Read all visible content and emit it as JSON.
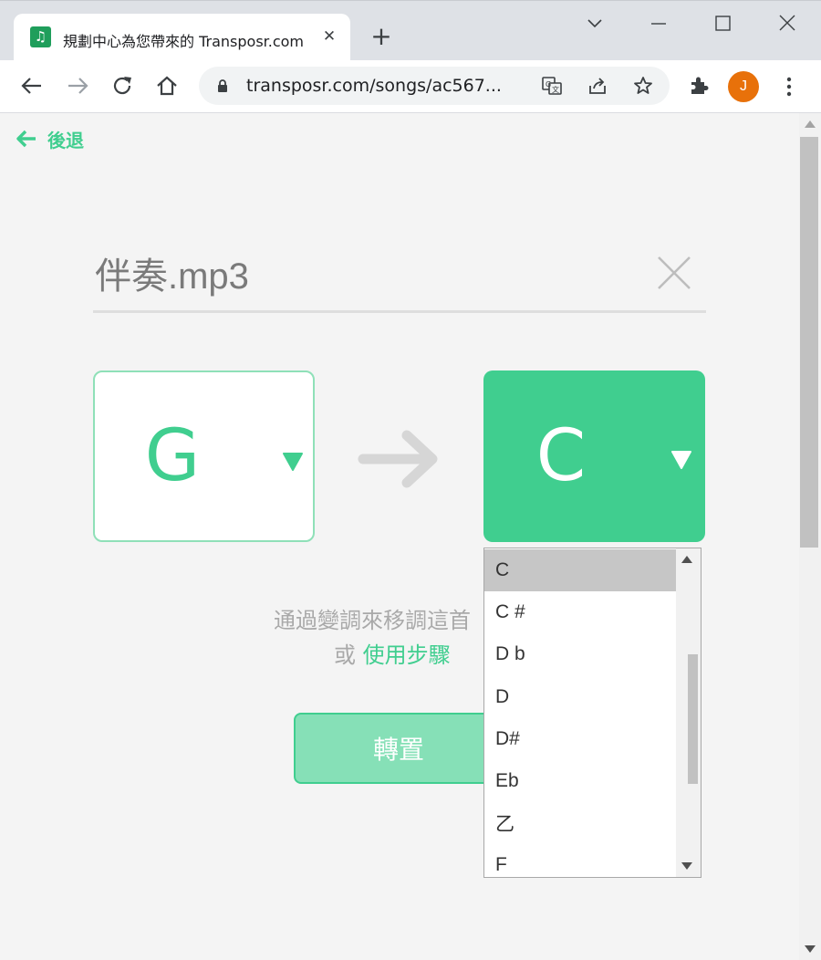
{
  "browser": {
    "tab_title": "規劃中心為您帶來的 Transposr.com",
    "tab_icon": "music-note-icon",
    "new_tab_label": "+",
    "url": "transposr.com/songs/ac567...",
    "avatar_initial": "J",
    "avatar_color": "#e8710a"
  },
  "page": {
    "back_label": "後退",
    "file_name": "伴奏.mp3",
    "from_key": "G",
    "to_key": "C",
    "description_line1": "通過變調來移調這首",
    "description_or": "或",
    "use_steps_link": "使用步驟",
    "transpose_button": "轉置",
    "accent_color": "#40ce8f"
  },
  "key_dropdown": {
    "selected": "C",
    "options": [
      "C",
      "C #",
      "D b",
      "D",
      "D#",
      "Eb",
      "乙",
      "F"
    ]
  }
}
